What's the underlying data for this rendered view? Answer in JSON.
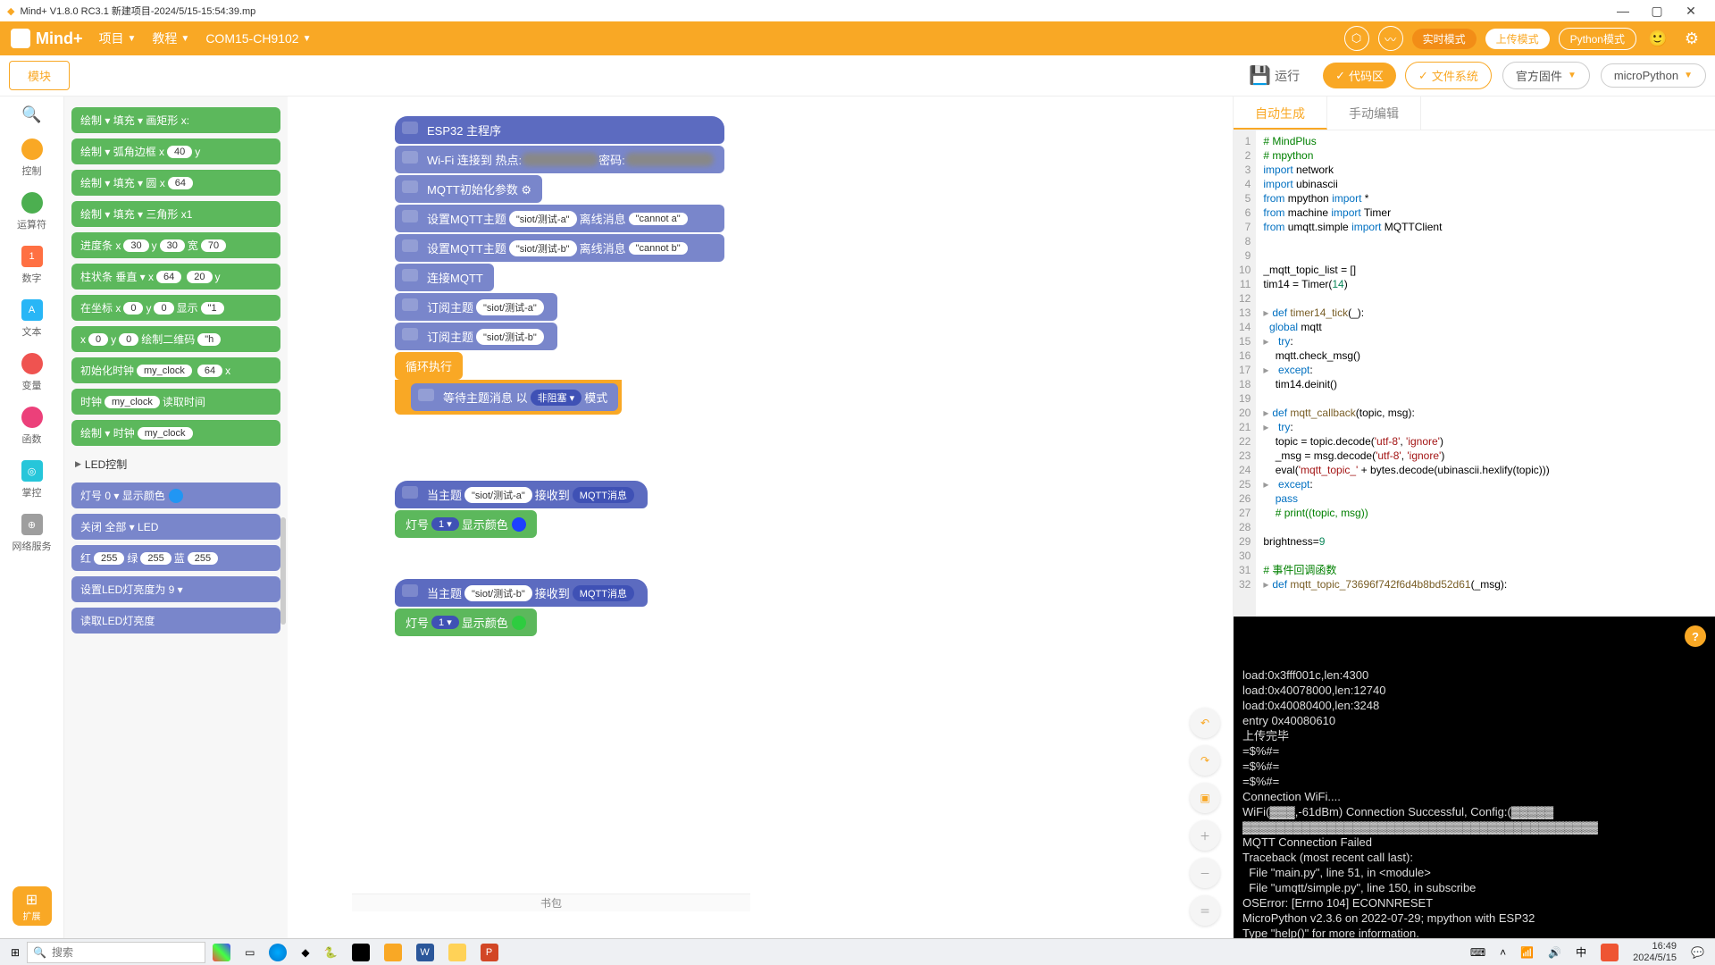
{
  "titlebar": {
    "text": "Mind+ V1.8.0 RC3.1   新建项目-2024/5/15-15:54:39.mp"
  },
  "menubar": {
    "logo": "Mind+",
    "project": "项目",
    "tutorial": "教程",
    "port": "COM15-CH9102",
    "mode_rt": "实时模式",
    "mode_up": "上传模式",
    "mode_py": "Python模式"
  },
  "toolrow": {
    "module": "模块",
    "run": "运行",
    "code_area": "代码区",
    "file_sys": "文件系统",
    "firmware": "官方固件",
    "micropython": "microPython"
  },
  "categories": [
    {
      "label": "控制",
      "color": "#f9a825",
      "dot": true
    },
    {
      "label": "运算符",
      "color": "#4caf50",
      "dot": true
    },
    {
      "label": "数字",
      "color": "#ff7043",
      "sq": "1"
    },
    {
      "label": "文本",
      "color": "#29b6f6",
      "sq": "A"
    },
    {
      "label": "变量",
      "color": "#ef5350",
      "dot": true
    },
    {
      "label": "函数",
      "color": "#ec407a",
      "dot": true
    },
    {
      "label": "掌控",
      "color": "#26c6da",
      "sq": "◎"
    },
    {
      "label": "网络服务",
      "color": "#9e9e9e",
      "sq": "⊕"
    }
  ],
  "ext_label": "扩展",
  "palette": {
    "led_header": "LED控制",
    "blocks": [
      {
        "cls": "blk-g",
        "text": "绘制 ▾  填充 ▾  画矩形 x:"
      },
      {
        "cls": "blk-g",
        "text": "绘制 ▾  弧角边框 x ",
        "b": [
          "40"
        ],
        "tail": " y"
      },
      {
        "cls": "blk-g",
        "text": "绘制 ▾  填充 ▾  圆 x ",
        "b": [
          "64"
        ]
      },
      {
        "cls": "blk-g",
        "text": "绘制 ▾  填充 ▾  三角形 x1"
      },
      {
        "cls": "blk-g",
        "text": "进度条 x ",
        "b": [
          "30"
        ],
        "mid": " y ",
        "b2": [
          "30"
        ],
        "tail": " 宽 ",
        "b3": [
          "70"
        ]
      },
      {
        "cls": "blk-g",
        "text": "柱状条  垂直 ▾  x ",
        "b": [
          "64"
        ],
        "tail": " y ",
        "b2": [
          "20"
        ]
      },
      {
        "cls": "blk-g",
        "text": "在坐标 x ",
        "b": [
          "0"
        ],
        "mid": " y ",
        "b2": [
          "0"
        ],
        "tail": " 显示 ",
        "b3": [
          "\"1"
        ]
      },
      {
        "cls": "blk-g",
        "text": "x ",
        "b": [
          "0"
        ],
        "mid": " y ",
        "b2": [
          "0"
        ],
        "tail": " 绘制二维码 ",
        "b3": [
          "\"h"
        ]
      },
      {
        "cls": "blk-g",
        "text": "初始化时钟 ",
        "b": [
          "my_clock"
        ],
        "tail": " x ",
        "b2": [
          "64"
        ]
      },
      {
        "cls": "blk-g",
        "text": "时钟 ",
        "b": [
          "my_clock"
        ],
        "tail": " 读取时间"
      },
      {
        "cls": "blk-g",
        "text": "绘制 ▾  时钟 ",
        "b": [
          "my_clock"
        ]
      }
    ],
    "led_blocks": [
      {
        "cls": "blk-p",
        "text": "灯号 0 ▾  显示颜色 ",
        "dot": "#2196f3"
      },
      {
        "cls": "blk-p",
        "text": "关闭  全部 ▾  LED"
      },
      {
        "cls": "blk-p",
        "text": "红 ",
        "b": [
          "255"
        ],
        "mid": " 绿 ",
        "b2": [
          "255"
        ],
        "tail": " 蓝 ",
        "b3": [
          "255"
        ]
      },
      {
        "cls": "blk-p",
        "text": "设置LED灯亮度为  9 ▾"
      },
      {
        "cls": "blk-p",
        "text": "读取LED灯亮度"
      }
    ]
  },
  "canvas": {
    "stack1": {
      "hat": "ESP32 主程序",
      "wifi_pre": "Wi-Fi 连接到 热点:",
      "wifi_mid": " 密码:",
      "mqtt_init": "MQTT初始化参数 ⚙",
      "set_topic": "设置MQTT主题",
      "topic_a": "\"siot/测试-a\"",
      "topic_b": "\"siot/测试-b\"",
      "offline": "离线消息",
      "cannot_a": "\"cannot a\"",
      "cannot_b": "\"cannot b\"",
      "connect": "连接MQTT",
      "subscribe": "订阅主题",
      "loop": "循环执行",
      "wait_pre": "等待主题消息 以",
      "nonblock": "非阻塞 ▾",
      "wait_post": "模式"
    },
    "stack2": {
      "when_pre": "当主题",
      "when_post": "接收到",
      "mqtt_msg": "MQTT消息",
      "led": "灯号",
      "led_num": "1 ▾",
      "show_color": "显示颜色"
    }
  },
  "bottombar": "书包",
  "code_tabs": {
    "auto": "自动生成",
    "manual": "手动编辑"
  },
  "code_lines": [
    {
      "n": 1,
      "html": "<span class='cmt'># MindPlus</span>"
    },
    {
      "n": 2,
      "html": "<span class='cmt'># mpython</span>"
    },
    {
      "n": 3,
      "html": "<span class='kw'>import</span> network"
    },
    {
      "n": 4,
      "html": "<span class='kw'>import</span> ubinascii"
    },
    {
      "n": 5,
      "html": "<span class='kw'>from</span> mpython <span class='kw'>import</span> *"
    },
    {
      "n": 6,
      "html": "<span class='kw'>from</span> machine <span class='kw'>import</span> Timer"
    },
    {
      "n": 7,
      "html": "<span class='kw'>from</span> umqtt.simple <span class='kw'>import</span> MQTTClient"
    },
    {
      "n": 8,
      "html": ""
    },
    {
      "n": 9,
      "html": ""
    },
    {
      "n": 10,
      "html": "_mqtt_topic_list = []"
    },
    {
      "n": 11,
      "html": "tim14 = Timer(<span class='num'>14</span>)"
    },
    {
      "n": 12,
      "html": ""
    },
    {
      "n": 13,
      "fold": "▸",
      "html": "<span class='kw'>def</span> <span class='fn'>timer14_tick</span>(_):"
    },
    {
      "n": 14,
      "html": "  <span class='kw'>global</span> mqtt"
    },
    {
      "n": 15,
      "fold": "▸",
      "html": "  <span class='kw'>try</span>:"
    },
    {
      "n": 16,
      "html": "    mqtt.check_msg()"
    },
    {
      "n": 17,
      "fold": "▸",
      "html": "  <span class='kw'>except</span>:"
    },
    {
      "n": 18,
      "html": "    tim14.deinit()"
    },
    {
      "n": 19,
      "html": ""
    },
    {
      "n": 20,
      "fold": "▸",
      "html": "<span class='kw'>def</span> <span class='fn'>mqtt_callback</span>(topic, msg):"
    },
    {
      "n": 21,
      "fold": "▸",
      "html": "  <span class='kw'>try</span>:"
    },
    {
      "n": 22,
      "html": "    topic = topic.decode(<span class='str'>'utf-8'</span>, <span class='str'>'ignore'</span>)"
    },
    {
      "n": 23,
      "html": "    _msg = msg.decode(<span class='str'>'utf-8'</span>, <span class='str'>'ignore'</span>)"
    },
    {
      "n": 24,
      "html": "    eval(<span class='str'>'mqtt_topic_'</span> + bytes.decode(ubinascii.hexlify(topic)))"
    },
    {
      "n": 25,
      "fold": "▸",
      "html": "  <span class='kw'>except</span>:"
    },
    {
      "n": 26,
      "html": "    <span class='kw'>pass</span>"
    },
    {
      "n": 27,
      "html": "    <span class='cmt'># print((topic, msg))</span>"
    },
    {
      "n": 28,
      "html": ""
    },
    {
      "n": 29,
      "html": "brightness=<span class='num'>9</span>"
    },
    {
      "n": 30,
      "html": ""
    },
    {
      "n": 31,
      "html": "<span class='cmt'># 事件回调函数</span>"
    },
    {
      "n": 32,
      "fold": "▸",
      "html": "<span class='kw'>def</span> <span class='fn'>mqtt_topic_73696f742f6d4b8bd52d61</span>(_msg):"
    }
  ],
  "terminal_lines": [
    "load:0x3fff001c,len:4300",
    "load:0x40078000,len:12740",
    "load:0x40080400,len:3248",
    "entry 0x40080610",
    "上传完毕",
    "",
    "=$%#=",
    "=$%#=",
    "=$%#=",
    "Connection WiFi....",
    "WiFi(▓▓▓,-61dBm) Connection Successful, Config:(▓▓▓▓▓",
    "▓▓▓▓▓▓▓▓▓▓▓▓▓▓▓▓▓▓▓▓▓▓▓▓▓▓▓▓▓▓▓▓▓▓▓▓▓▓▓▓▓▓",
    "MQTT Connection Failed",
    "Traceback (most recent call last):",
    "  File \"main.py\", line 51, in <module>",
    "  File \"umqtt/simple.py\", line 150, in subscribe",
    "OSError: [Errno 104] ECONNRESET",
    "MicroPython v2.3.6 on 2022-07-29; mpython with ESP32",
    "Type \"help()\" for more information.",
    ">>> ",
    ">>> |"
  ],
  "taskbar": {
    "search": "搜索",
    "time": "16:49",
    "date": "2024/5/15"
  }
}
